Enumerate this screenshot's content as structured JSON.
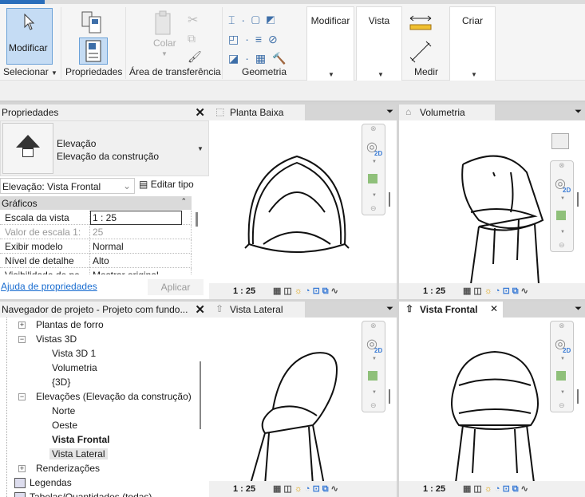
{
  "ribbon": {
    "modify": "Modificar",
    "select": "Selecionar",
    "properties": "Propriedades",
    "paste": "Colar",
    "clipboard": "Área de transferência",
    "geometry": "Geometria",
    "modify_panel": "Modificar",
    "view_panel": "Vista",
    "measure": "Medir",
    "create": "Criar"
  },
  "properties": {
    "title": "Propriedades",
    "type_line1": "Elevação",
    "type_line2": "Elevação da construção",
    "selector": "Elevação: Vista Frontal",
    "edit_type": "Editar tipo",
    "group": "Gráficos",
    "rows": [
      {
        "name": "Escala da vista",
        "value": "1 : 25"
      },
      {
        "name": "Valor de escala    1:",
        "value": "25"
      },
      {
        "name": "Exibir modelo",
        "value": "Normal"
      },
      {
        "name": "Nível de detalhe",
        "value": "Alto"
      },
      {
        "name": "Visibilidade de pe...",
        "value": "Mostrar original"
      }
    ],
    "help": "Ajuda de propriedades",
    "apply": "Aplicar"
  },
  "browser": {
    "title": "Navegador de projeto - Projeto com fundo...",
    "items": [
      "Plantas de forro",
      "Vistas 3D",
      "Vista 3D 1",
      "Volumetria",
      "{3D}",
      "Elevações (Elevação da construção)",
      "Norte",
      "Oeste",
      "Vista Frontal",
      "Vista Lateral",
      "Renderizações",
      "Legendas",
      "Tabelas/Quantidades (todas)"
    ]
  },
  "views": [
    {
      "title": "Planta Baixa",
      "scale": "1 : 25"
    },
    {
      "title": "Volumetria",
      "scale": "1 : 25"
    },
    {
      "title": "Vista Lateral",
      "scale": "1 : 25"
    },
    {
      "title": "Vista Frontal",
      "scale": "1 : 25"
    }
  ],
  "accent": "#2a6ebb"
}
